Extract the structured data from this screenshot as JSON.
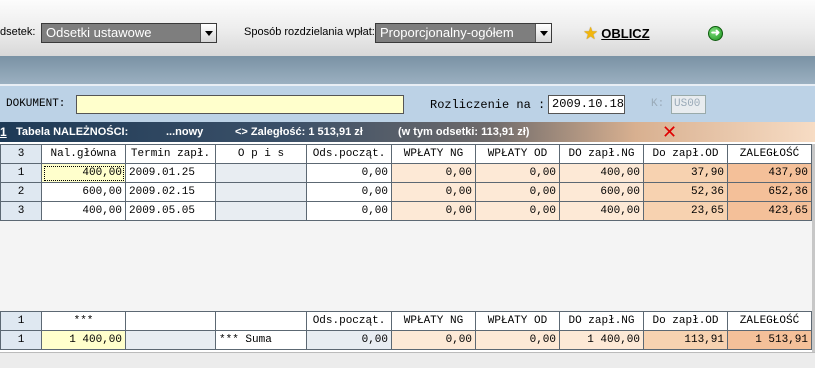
{
  "toolbar": {
    "odsetek_label": "dsetek:",
    "odsetek_value": "Odsetki ustawowe",
    "sposob_label": "Sposób rozdzielania wpłat:",
    "sposob_value": "Proporcjonalny-ogółem",
    "oblicz_label": "OBLICZ",
    "star_icon": "star-icon",
    "go_icon": "arrow-right-circle-icon"
  },
  "document": {
    "label": "DOKUMENT:",
    "value": "",
    "rozliczenie_label": "Rozliczenie na :",
    "rozliczenie_value": "2009.10.18",
    "k_label": "K:",
    "k_value": "US00"
  },
  "section": {
    "number": "1",
    "title": "Tabela NALEŻNOŚCI:",
    "nowy": "...nowy",
    "zaleglosc": "<> Zaległość: 1 513,91 zł",
    "odsetki": "(w tym odsetki: 113,91 zł)"
  },
  "table": {
    "headers": [
      "3",
      "Nal.główna",
      "Termin zapł.",
      "O p i s",
      "Ods.począt.",
      "WPŁATY NG",
      "WPŁATY OD",
      "DO zapł.NG",
      "Do zapł.OD",
      "ZALEGŁOŚĆ"
    ],
    "rows": [
      [
        "1",
        "400,00",
        "2009.01.25",
        "",
        "0,00",
        "0,00",
        "0,00",
        "400,00",
        "37,90",
        "437,90"
      ],
      [
        "2",
        "600,00",
        "2009.02.15",
        "",
        "0,00",
        "0,00",
        "0,00",
        "600,00",
        "52,36",
        "652,36"
      ],
      [
        "3",
        "400,00",
        "2009.05.05",
        "",
        "0,00",
        "0,00",
        "0,00",
        "400,00",
        "23,65",
        "423,65"
      ]
    ]
  },
  "summary": {
    "headers": [
      "1",
      "***",
      "",
      "",
      "Ods.począt.",
      "WPŁATY NG",
      "WPŁATY OD",
      "DO zapł.NG",
      "Do zapł.OD",
      "ZALEGŁOŚĆ"
    ],
    "row": [
      "1",
      "1 400,00",
      "",
      "*** Suma",
      "0,00",
      "0,00",
      "0,00",
      "1 400,00",
      "113,91",
      "1 513,91"
    ]
  },
  "colors": {
    "input_yellow": "#ffffcc",
    "header_navy": "#1e3a56",
    "salmon": "#f4c099",
    "close_red": "#e00000"
  }
}
